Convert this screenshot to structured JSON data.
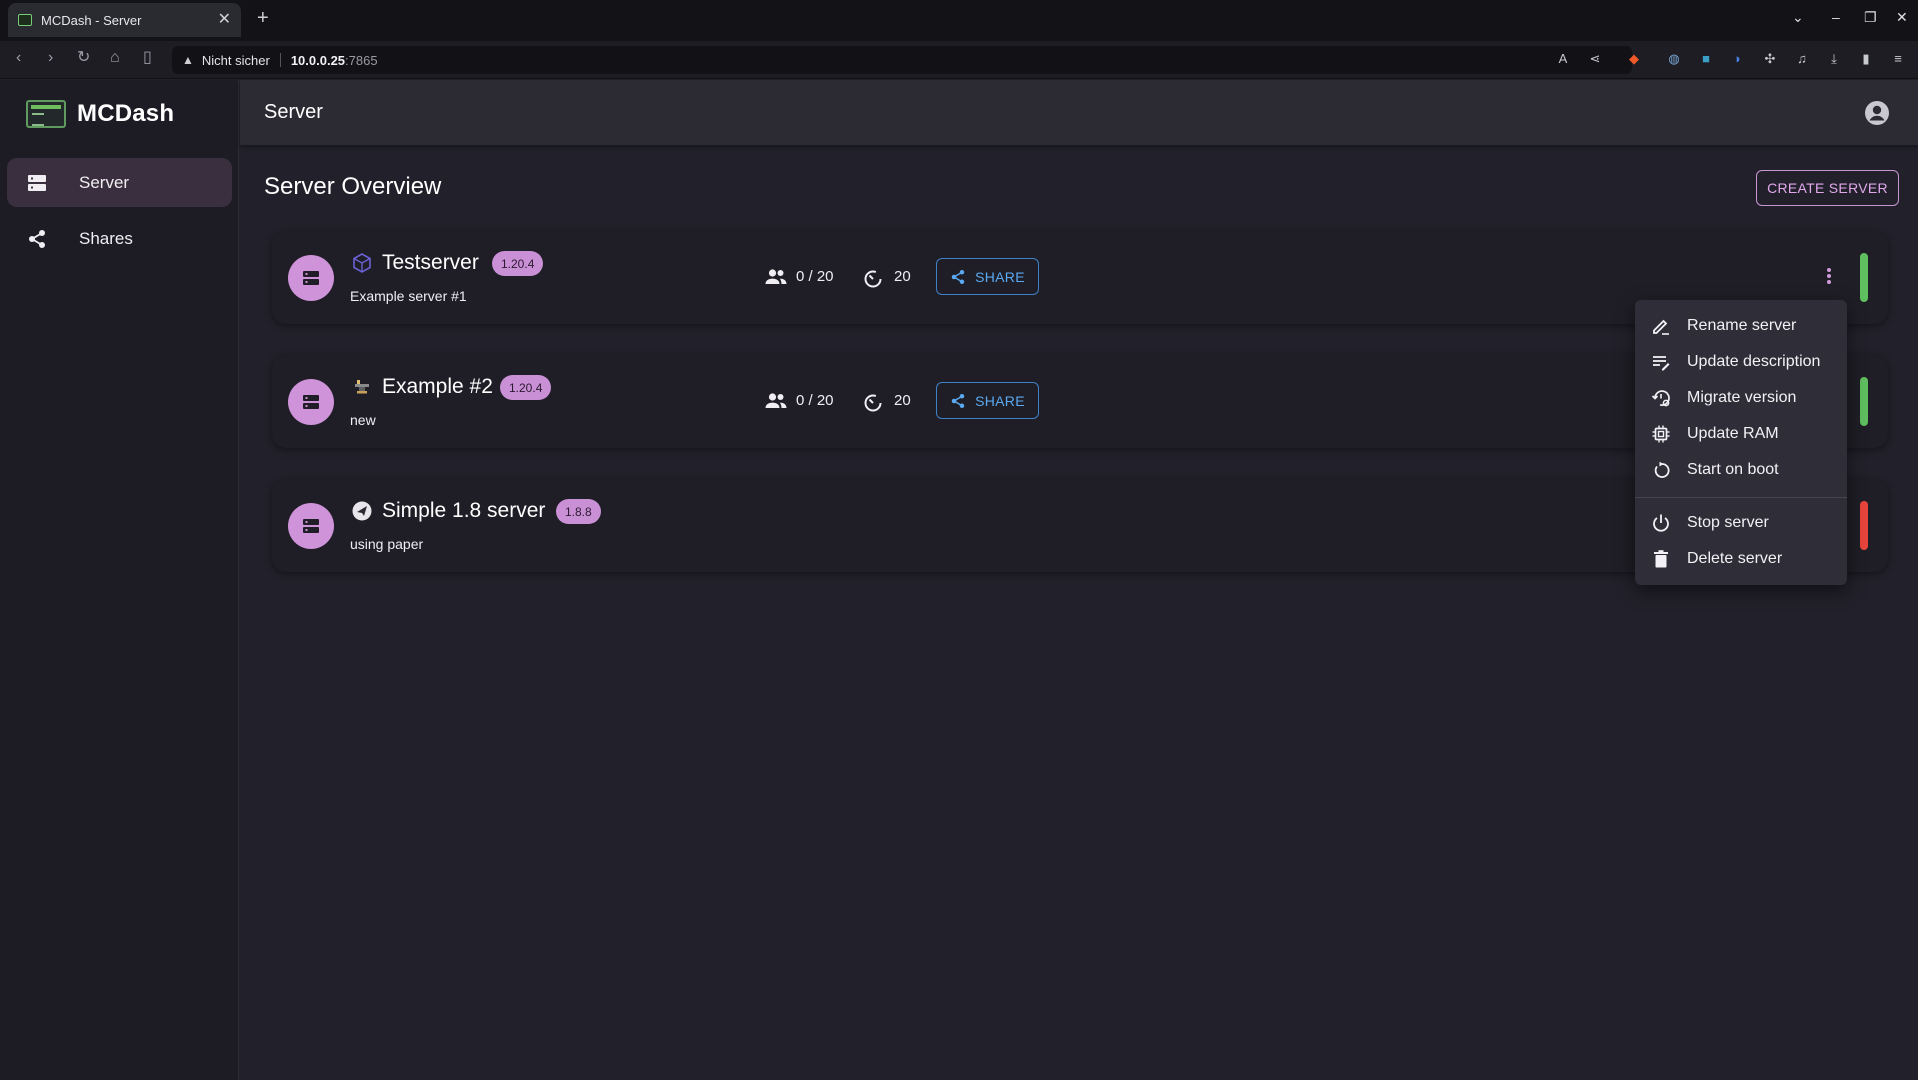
{
  "browser": {
    "tab_title": "MCDash - Server",
    "not_secure": "Nicht sicher",
    "url_host": "10.0.0.25",
    "url_port": ":7865"
  },
  "app": {
    "name": "MCDash",
    "topbar_title": "Server"
  },
  "sidebar": {
    "items": [
      {
        "label": "Server",
        "icon": "server-icon",
        "active": true
      },
      {
        "label": "Shares",
        "icon": "share-icon",
        "active": false
      }
    ]
  },
  "main": {
    "title": "Server Overview",
    "create_button": "CREATE SERVER",
    "share_label": "SHARE"
  },
  "servers": [
    {
      "name": "Testserver",
      "version": "1.20.4",
      "description": "Example server #1",
      "players": "0 / 20",
      "view_distance": "20",
      "type_icon": "cube-icon",
      "status": "running",
      "status_color": "#5fbf5f"
    },
    {
      "name": "Example #2",
      "version": "1.20.4",
      "description": "new",
      "players": "0 / 20",
      "view_distance": "20",
      "type_icon": "anvil-icon",
      "status": "running",
      "status_color": "#5fbf5f"
    },
    {
      "name": "Simple 1.8 server",
      "version": "1.8.8",
      "description": "using paper",
      "type_icon": "paper-plane-icon",
      "status": "stopped",
      "status_color": "#e8453c"
    }
  ],
  "context_menu": {
    "items": [
      {
        "label": "Rename server",
        "icon": "edit-icon"
      },
      {
        "label": "Update description",
        "icon": "edit-note-icon"
      },
      {
        "label": "Migrate version",
        "icon": "history-settings-icon"
      },
      {
        "label": "Update RAM",
        "icon": "memory-icon"
      },
      {
        "label": "Start on boot",
        "icon": "restart-icon"
      },
      {
        "label": "Stop server",
        "icon": "power-icon"
      },
      {
        "label": "Delete server",
        "icon": "trash-icon"
      }
    ]
  },
  "colors": {
    "accent": "#ce93d8",
    "share": "#5aa9f2",
    "running": "#5fbf5f",
    "stopped": "#e8453c"
  }
}
